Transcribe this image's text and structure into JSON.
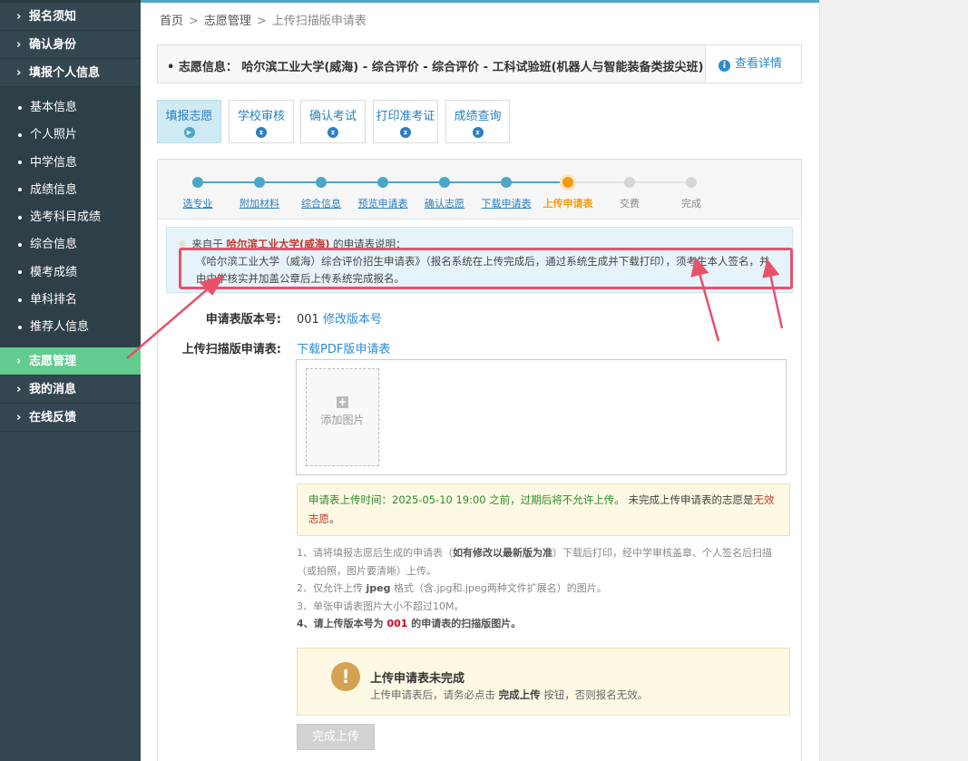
{
  "sidebar": {
    "top_items": [
      {
        "label": "报名须知"
      },
      {
        "label": "确认身份"
      },
      {
        "label": "填报个人信息"
      }
    ],
    "sub_items": [
      {
        "label": "基本信息"
      },
      {
        "label": "个人照片"
      },
      {
        "label": "中学信息"
      },
      {
        "label": "成绩信息"
      },
      {
        "label": "选考科目成绩"
      },
      {
        "label": "综合信息"
      },
      {
        "label": "模考成绩"
      },
      {
        "label": "单科排名"
      },
      {
        "label": "推荐人信息"
      }
    ],
    "bottom_items": [
      {
        "label": "志愿管理"
      },
      {
        "label": "我的消息"
      },
      {
        "label": "在线反馈"
      }
    ]
  },
  "breadcrumb": {
    "home": "首页",
    "level2": "志愿管理",
    "current": "上传扫描版申请表",
    "separator": ">"
  },
  "info": {
    "bullet": "•",
    "text": "志愿信息：  哈尔滨工业大学(威海) - 综合评价 - 综合评价 - 工科试验班(机器人与智能装备类拔尖班)",
    "detail_label": "查看详情"
  },
  "tabs": [
    {
      "label": "填报志愿"
    },
    {
      "label": "学校审核"
    },
    {
      "label": "确认考试"
    },
    {
      "label": "打印准考证"
    },
    {
      "label": "成绩查询"
    }
  ],
  "steps": [
    {
      "label": "选专业"
    },
    {
      "label": "附加材料"
    },
    {
      "label": "综合信息"
    },
    {
      "label": "预览申请表"
    },
    {
      "label": "确认志愿"
    },
    {
      "label": "下载申请表"
    },
    {
      "label": "上传申请表"
    },
    {
      "label": "交费"
    },
    {
      "label": "完成"
    }
  ],
  "steps_current_index": 6,
  "notice": {
    "prefix": "来自于",
    "school": "哈尔滨工业大学(威海)",
    "suffix": "的申请表说明：",
    "body": "《哈尔滨工业大学（威海）综合评价招生申请表》（报名系统在上传完成后，通过系统生成并下载打印），须考生本人签名，并由中学核实并加盖公章后上传系统完成报名。"
  },
  "form": {
    "version_label": "申请表版本号:",
    "version_value": "001",
    "version_link": "修改版本号",
    "upload_label": "上传扫描版申请表:",
    "download_link": "下载PDF版申请表",
    "add_image": "添加图片"
  },
  "warning": {
    "part1": "申请表上传时间：2025-05-10 19:00 之前，过期后将不允许上传。",
    "part2": "未完成上传申请表的志愿是",
    "part3": "无效志愿",
    "part4": "。"
  },
  "tips": {
    "t1a": "1、请将填报志愿后生成的申请表（",
    "t1b": "如有修改以最新版为准",
    "t1c": "）下载后打印，经中学审核盖章、个人签名后扫描（或拍照，图片要清晰）上传。",
    "t2a": "2、仅允许上传 ",
    "t2b": "jpeg",
    "t2c": " 格式（含.jpg和.jpeg两种文件扩展名）的图片。",
    "t3": "3、单张申请表图片大小不超过10M。",
    "t4a": "4、请上传版本号为 ",
    "t4b": "001",
    "t4c": " 的申请表的扫描版图片。"
  },
  "status": {
    "icon": "!",
    "title": "上传申请表未完成",
    "desc_a": "上传申请表后，请务必点击 ",
    "desc_b": "完成上传",
    "desc_c": " 按钮，否则报名无效。"
  },
  "finish_button": "完成上传",
  "colors": {
    "sidebar_bg": "#34464f",
    "sidebar_active": "#62cc8f",
    "accent_blue": "#2a8bd0",
    "step_current": "#f39c12",
    "annotation_red": "#e5536a"
  }
}
